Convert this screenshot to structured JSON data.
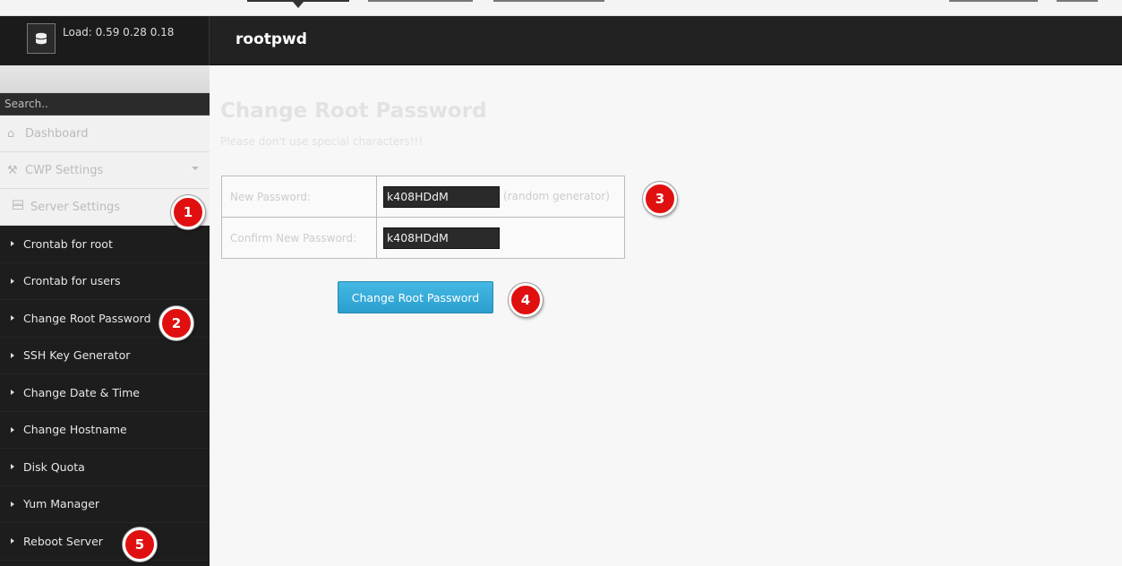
{
  "header": {
    "load_label": "Load: 0.59  0.28  0.18",
    "page_heading": "rootpwd",
    "server_icon": "database-icon"
  },
  "sidebar": {
    "search_placeholder": "Search..",
    "dashboard_label": "Dashboard",
    "dashboard_icon": "home-icon",
    "cwp_settings_label": "CWP Settings",
    "cwp_settings_icon": "wrench-icon",
    "server_settings_label": "Server Settings",
    "server_settings_icon": "server-icon",
    "items": [
      {
        "label": "Crontab for root"
      },
      {
        "label": "Crontab for users"
      },
      {
        "label": "Change Root Password"
      },
      {
        "label": "SSH Key Generator"
      },
      {
        "label": "Change Date & Time"
      },
      {
        "label": "Change Hostname"
      },
      {
        "label": "Disk Quota"
      },
      {
        "label": "Yum Manager"
      },
      {
        "label": "Reboot Server"
      }
    ]
  },
  "main": {
    "title": "Change Root Password",
    "subtitle": "Please don't use special characters!!!",
    "form": {
      "new_password_label": "New Password:",
      "new_password_value": "k408HDdM",
      "random_generator_label": "(random generator)",
      "confirm_password_label": "Confirm New Password:",
      "confirm_password_value": "k408HDdM"
    },
    "submit_label": "Change Root Password"
  },
  "markers": [
    "1",
    "2",
    "3",
    "4",
    "5"
  ],
  "colors": {
    "marker": "#e01010",
    "button": "#2a9fcf",
    "header": "#222222",
    "sidebar": "#1d1d1d"
  }
}
